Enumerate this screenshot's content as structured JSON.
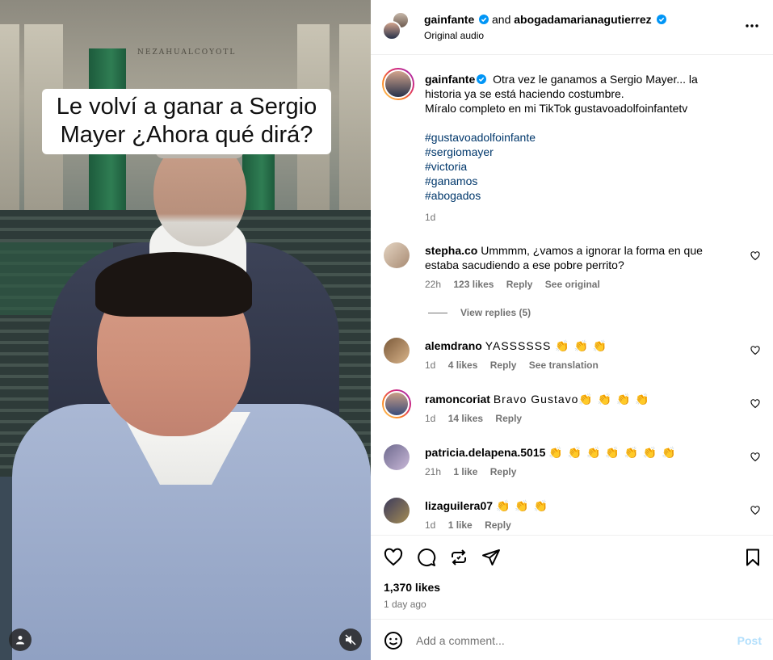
{
  "media": {
    "wall_text": "NEZAHUALCOYOTL",
    "caption": "Le volví a ganar a Sergio Mayer ¿Ahora qué dirá?",
    "tag_icon": "person-tag-icon",
    "mute_icon": "speaker-muted-icon"
  },
  "header": {
    "user1": "gainfante",
    "conjunction": "and",
    "user2": "abogadamarianagutierrez",
    "audio": "Original audio",
    "more_icon": "more-horizontal-icon"
  },
  "caption_post": {
    "user": "gainfante",
    "text": "Otra vez le ganamos a Sergio Mayer... la historia ya se está haciendo costumbre.",
    "text2": "Míralo completo en mi TikTok gustavoadolfoinfantetv",
    "hashtags": [
      "#gustavoadolfoinfante",
      "#sergiomayer",
      "#victoria",
      "#ganamos",
      "#abogados"
    ],
    "time": "1d"
  },
  "comments": [
    {
      "user": "stepha.co",
      "text": "Ummmm, ¿vamos a ignorar la forma en que estaba sacudiendo a ese pobre perrito?",
      "time": "22h",
      "likes": "123 likes",
      "reply": "Reply",
      "extra": "See original",
      "view_replies": "View replies (5)"
    },
    {
      "user": "alemdrano",
      "text": "YASSSSSS 👏 👏 👏",
      "time": "1d",
      "likes": "4 likes",
      "reply": "Reply",
      "extra": "See translation"
    },
    {
      "user": "ramoncoriat",
      "text": "Bravo Gustavo👏 👏 👏 👏",
      "time": "1d",
      "likes": "14 likes",
      "reply": "Reply",
      "extra": ""
    },
    {
      "user": "patricia.delapena.5015",
      "text": "👏 👏 👏 👏 👏 👏 👏",
      "time": "21h",
      "likes": "1 like",
      "reply": "Reply",
      "extra": ""
    },
    {
      "user": "lizaguilera07",
      "text": "👏 👏 👏",
      "time": "1d",
      "likes": "1 like",
      "reply": "Reply",
      "extra": ""
    }
  ],
  "actions": {
    "likes": "1,370 likes",
    "ago": "1 day ago",
    "icons": [
      "heart-icon",
      "comment-icon",
      "repost-icon",
      "share-icon",
      "bookmark-icon"
    ]
  },
  "add_comment": {
    "placeholder": "Add a comment...",
    "post_label": "Post"
  },
  "colors": {
    "verified": "#0095f6",
    "hashtag": "#00376b",
    "muted": "#737373",
    "post_disabled": "#b2dffc"
  }
}
